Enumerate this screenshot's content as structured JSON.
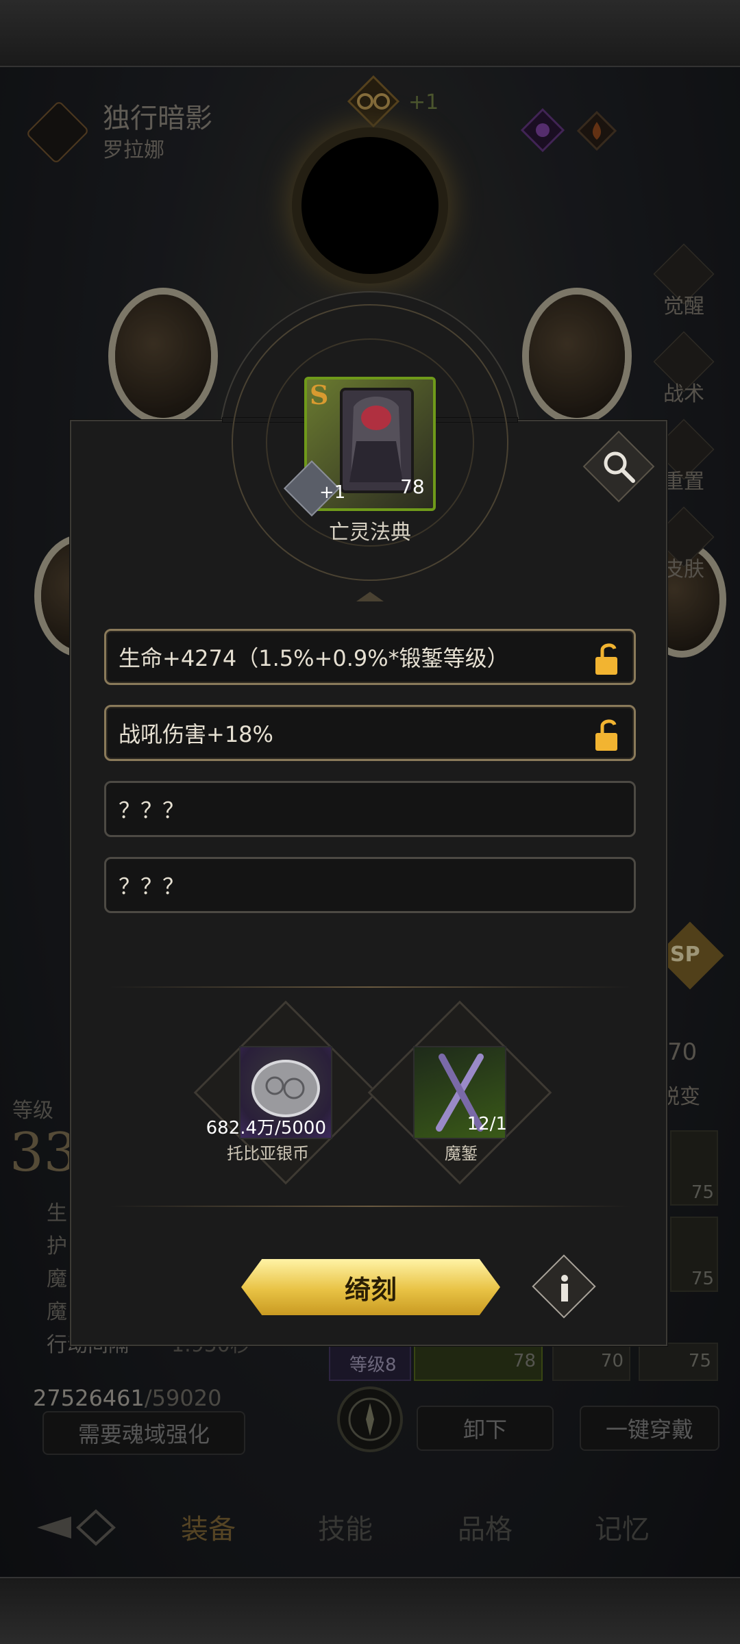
{
  "hero": {
    "title": "独行暗影",
    "subtitle": "罗拉娜",
    "bonus": "+1"
  },
  "side_buttons": [
    "觉醒",
    "战术",
    "重置",
    "皮肤"
  ],
  "side_extra": {
    "sp_label": "SP",
    "level_value": "70",
    "evolve_label": "蜕变"
  },
  "left_panel": {
    "level_label": "等级",
    "level_value": "33",
    "stat_rows": [
      "生",
      "护",
      "魔",
      "魔",
      "行动间隔"
    ],
    "action_value": "1.950秒",
    "soul_current": "27526461",
    "soul_sep": "/",
    "soul_max": "59020",
    "upgrade_btn": "需要魂域强化"
  },
  "gear_slots": [
    {
      "label": "等级8",
      "value": ""
    },
    {
      "label": "",
      "value": "78"
    },
    {
      "label": "",
      "value": "70"
    },
    {
      "label": "",
      "value": "75"
    }
  ],
  "right_slots": [
    "75",
    "75",
    "75"
  ],
  "action_buttons": {
    "unequip": "卸下",
    "equip_all": "一键穿戴"
  },
  "tabs": [
    "装备",
    "技能",
    "品格",
    "记忆"
  ],
  "dialog": {
    "item": {
      "name": "亡灵法典",
      "grade": "S",
      "plus": "+1",
      "level": "78"
    },
    "attributes": [
      {
        "text": "生命+4274（1.5%+0.9%*锻錾等级）",
        "locked": false
      },
      {
        "text": "战吼伤害+18%",
        "locked": false
      },
      {
        "text": "？？？",
        "locked": null
      },
      {
        "text": "？？？",
        "locked": null
      }
    ],
    "materials": [
      {
        "qty": "682.4万/5000",
        "name": "托比亚银币"
      },
      {
        "qty": "12/1",
        "name": "魔錾"
      }
    ],
    "action_label": "绮刻"
  },
  "colors": {
    "gold": "#e8c244",
    "item_border": "#6f9a1a",
    "lock": "#f2b431"
  }
}
